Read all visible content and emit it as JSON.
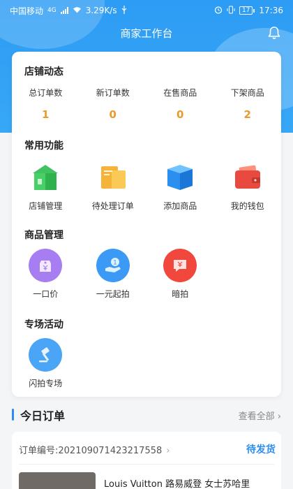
{
  "status_bar": {
    "carrier": "中国移动",
    "network": "4G",
    "speed": "3.29K/s",
    "battery": "17",
    "time": "17:36"
  },
  "header": {
    "title": "商家工作台"
  },
  "shop_dynamics": {
    "title": "店铺动态",
    "stats": [
      {
        "label": "总订单数",
        "value": "1"
      },
      {
        "label": "新订单数",
        "value": "0"
      },
      {
        "label": "在售商品",
        "value": "0"
      },
      {
        "label": "下架商品",
        "value": "2"
      }
    ]
  },
  "common_functions": {
    "title": "常用功能",
    "items": [
      {
        "label": "店铺管理",
        "icon": "store-icon"
      },
      {
        "label": "待处理订单",
        "icon": "pending-orders-icon"
      },
      {
        "label": "添加商品",
        "icon": "add-product-icon"
      },
      {
        "label": "我的钱包",
        "icon": "wallet-icon"
      }
    ]
  },
  "product_management": {
    "title": "商品管理",
    "items": [
      {
        "label": "一口价",
        "icon": "price-tag-icon"
      },
      {
        "label": "一元起拍",
        "icon": "one-yuan-auction-icon"
      },
      {
        "label": "暗拍",
        "icon": "sealed-auction-icon"
      }
    ]
  },
  "special_events": {
    "title": "专场活动",
    "items": [
      {
        "label": "闪拍专场",
        "icon": "gavel-icon"
      }
    ]
  },
  "today_orders": {
    "title": "今日订单",
    "view_all": "查看全部",
    "order": {
      "number_label": "订单编号:202109071423217558",
      "status": "待发货",
      "product_name": "Louis Vuitton 路易威登 女士苏哈里"
    }
  },
  "colors": {
    "primary": "#2d8cf0",
    "header_bg": "#37a7f6",
    "stat_value": "#e89a2a"
  }
}
